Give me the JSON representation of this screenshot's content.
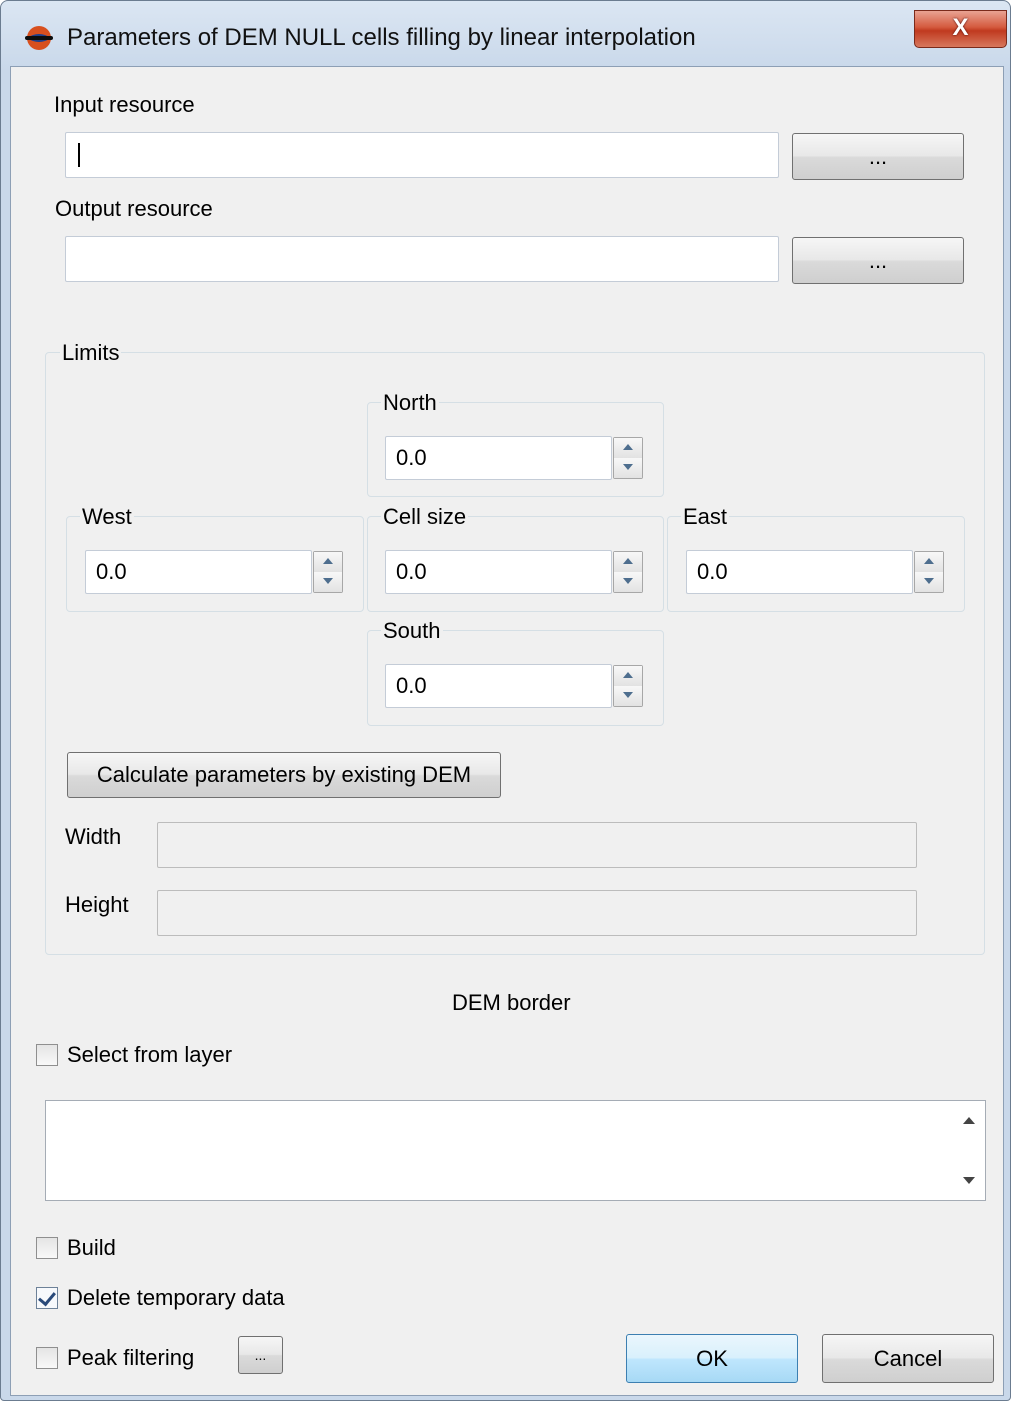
{
  "window": {
    "title": "Parameters of DEM NULL cells filling by linear interpolation",
    "close_glyph": "X"
  },
  "input_resource": {
    "label": "Input resource",
    "value": "",
    "browse_label": "..."
  },
  "output_resource": {
    "label": "Output resource",
    "value": "",
    "browse_label": "..."
  },
  "limits": {
    "title": "Limits",
    "north": {
      "label": "North",
      "value": "0.0"
    },
    "west": {
      "label": "West",
      "value": "0.0"
    },
    "cell_size": {
      "label": "Cell size",
      "value": "0.0"
    },
    "east": {
      "label": "East",
      "value": "0.0"
    },
    "south": {
      "label": "South",
      "value": "0.0"
    },
    "calculate_label": "Calculate parameters by existing DEM",
    "width_label": "Width",
    "width_value": "",
    "height_label": "Height",
    "height_value": ""
  },
  "dem_border": {
    "title": "DEM border",
    "select_from_layer_label": "Select from layer",
    "select_from_layer_checked": false,
    "text": ""
  },
  "options": {
    "build_label": "Build",
    "build_checked": false,
    "delete_temp_label": "Delete temporary data",
    "delete_temp_checked": true,
    "peak_filtering_label": "Peak filtering",
    "peak_filtering_checked": false,
    "peak_settings_label": "..."
  },
  "footer": {
    "ok_label": "OK",
    "cancel_label": "Cancel"
  },
  "colors": {
    "title_bar": "#c9d8ea",
    "client_bg": "#f0f0f0",
    "close_button": "#c8452a",
    "ok_button": "#bee6fd"
  }
}
